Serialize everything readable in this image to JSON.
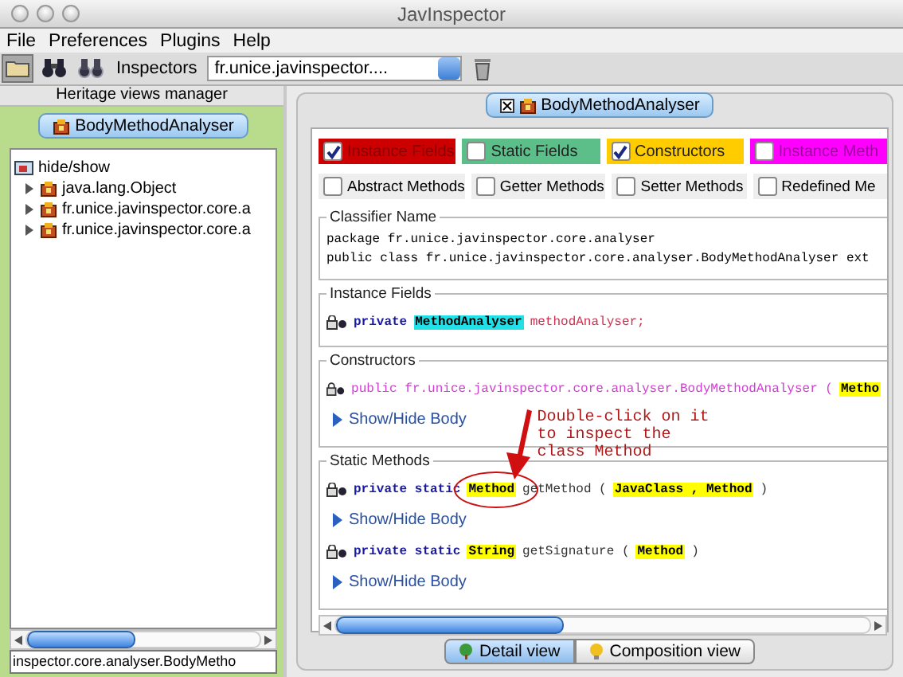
{
  "window": {
    "title": "JavInspector"
  },
  "menu": [
    "File",
    "Preferences",
    "Plugins",
    "Help"
  ],
  "toolbar": {
    "label": "Inspectors",
    "select": {
      "value": "fr.unice.javinspector...."
    }
  },
  "left": {
    "header": "Heritage views manager",
    "panel_title": "BodyMethodAnalyser",
    "tree": {
      "label": "hide/show",
      "children": [
        {
          "label": "java.lang.Object",
          "expanded": false
        },
        {
          "label": "fr.unice.javinspector.core.a",
          "expanded": false
        },
        {
          "label": "fr.unice.javinspector.core.a",
          "expanded": false
        }
      ]
    },
    "footer": "inspector.core.analyser.BodyMetho"
  },
  "right": {
    "panel_title": "BodyMethodAnalyser",
    "category_filters": [
      {
        "label": "Instance Fields",
        "checked": true,
        "color": "#cc0000"
      },
      {
        "label": "Static Fields",
        "checked": false,
        "color": "#5cbf8a"
      },
      {
        "label": "Constructors",
        "checked": true,
        "color": "#ffcc00"
      },
      {
        "label": "Instance Meth",
        "checked": false,
        "color": "#ff00ff"
      }
    ],
    "member_filters": [
      {
        "label": "Abstract Methods",
        "checked": false
      },
      {
        "label": "Getter Methods",
        "checked": false
      },
      {
        "label": "Setter Methods",
        "checked": false
      },
      {
        "label": "Redefined Me",
        "checked": false
      }
    ],
    "sections": [
      {
        "title": "Classifier Name",
        "kind": "text",
        "lines": [
          "package fr.unice.javinspector.core.analyser",
          "public class fr.unice.javinspector.core.analyser.BodyMethodAnalyser ext"
        ]
      },
      {
        "title": "Instance Fields",
        "kind": "members",
        "members": [
          {
            "tokens": [
              {
                "kind": "keyword",
                "text": "private"
              },
              {
                "kind": "ref",
                "text": "MethodAnalyser"
              },
              {
                "kind": "field",
                "text": "methodAnalyser;"
              }
            ]
          }
        ]
      },
      {
        "title": "Constructors",
        "kind": "members",
        "members": [
          {
            "tokens": [
              {
                "kind": "ctor",
                "text": "public fr.unice.javinspector.core.analyser.BodyMethodAnalyser ("
              },
              {
                "kind": "type",
                "text": "Metho"
              }
            ],
            "toggle": "Show/Hide Body"
          }
        ]
      },
      {
        "title": "Static Methods",
        "kind": "members",
        "members": [
          {
            "tokens": [
              {
                "kind": "keyword",
                "text": "private static"
              },
              {
                "kind": "type",
                "text": "Method",
                "circled": true
              },
              {
                "kind": "text",
                "text": "getMethod ("
              },
              {
                "kind": "type",
                "text": "JavaClass , Method"
              },
              {
                "kind": "text",
                "text": ")"
              }
            ],
            "toggle": "Show/Hide Body"
          },
          {
            "tokens": [
              {
                "kind": "keyword",
                "text": "private static"
              },
              {
                "kind": "type",
                "text": "String"
              },
              {
                "kind": "text",
                "text": "getSignature ("
              },
              {
                "kind": "type",
                "text": "Method"
              },
              {
                "kind": "text",
                "text": ")"
              }
            ],
            "toggle": "Show/Hide Body"
          }
        ]
      }
    ],
    "annotation": "Double-click on it\nto inspect the\nclass Method",
    "view_tabs": [
      {
        "label": "Detail view",
        "selected": true
      },
      {
        "label": "Composition view",
        "selected": false
      }
    ]
  }
}
